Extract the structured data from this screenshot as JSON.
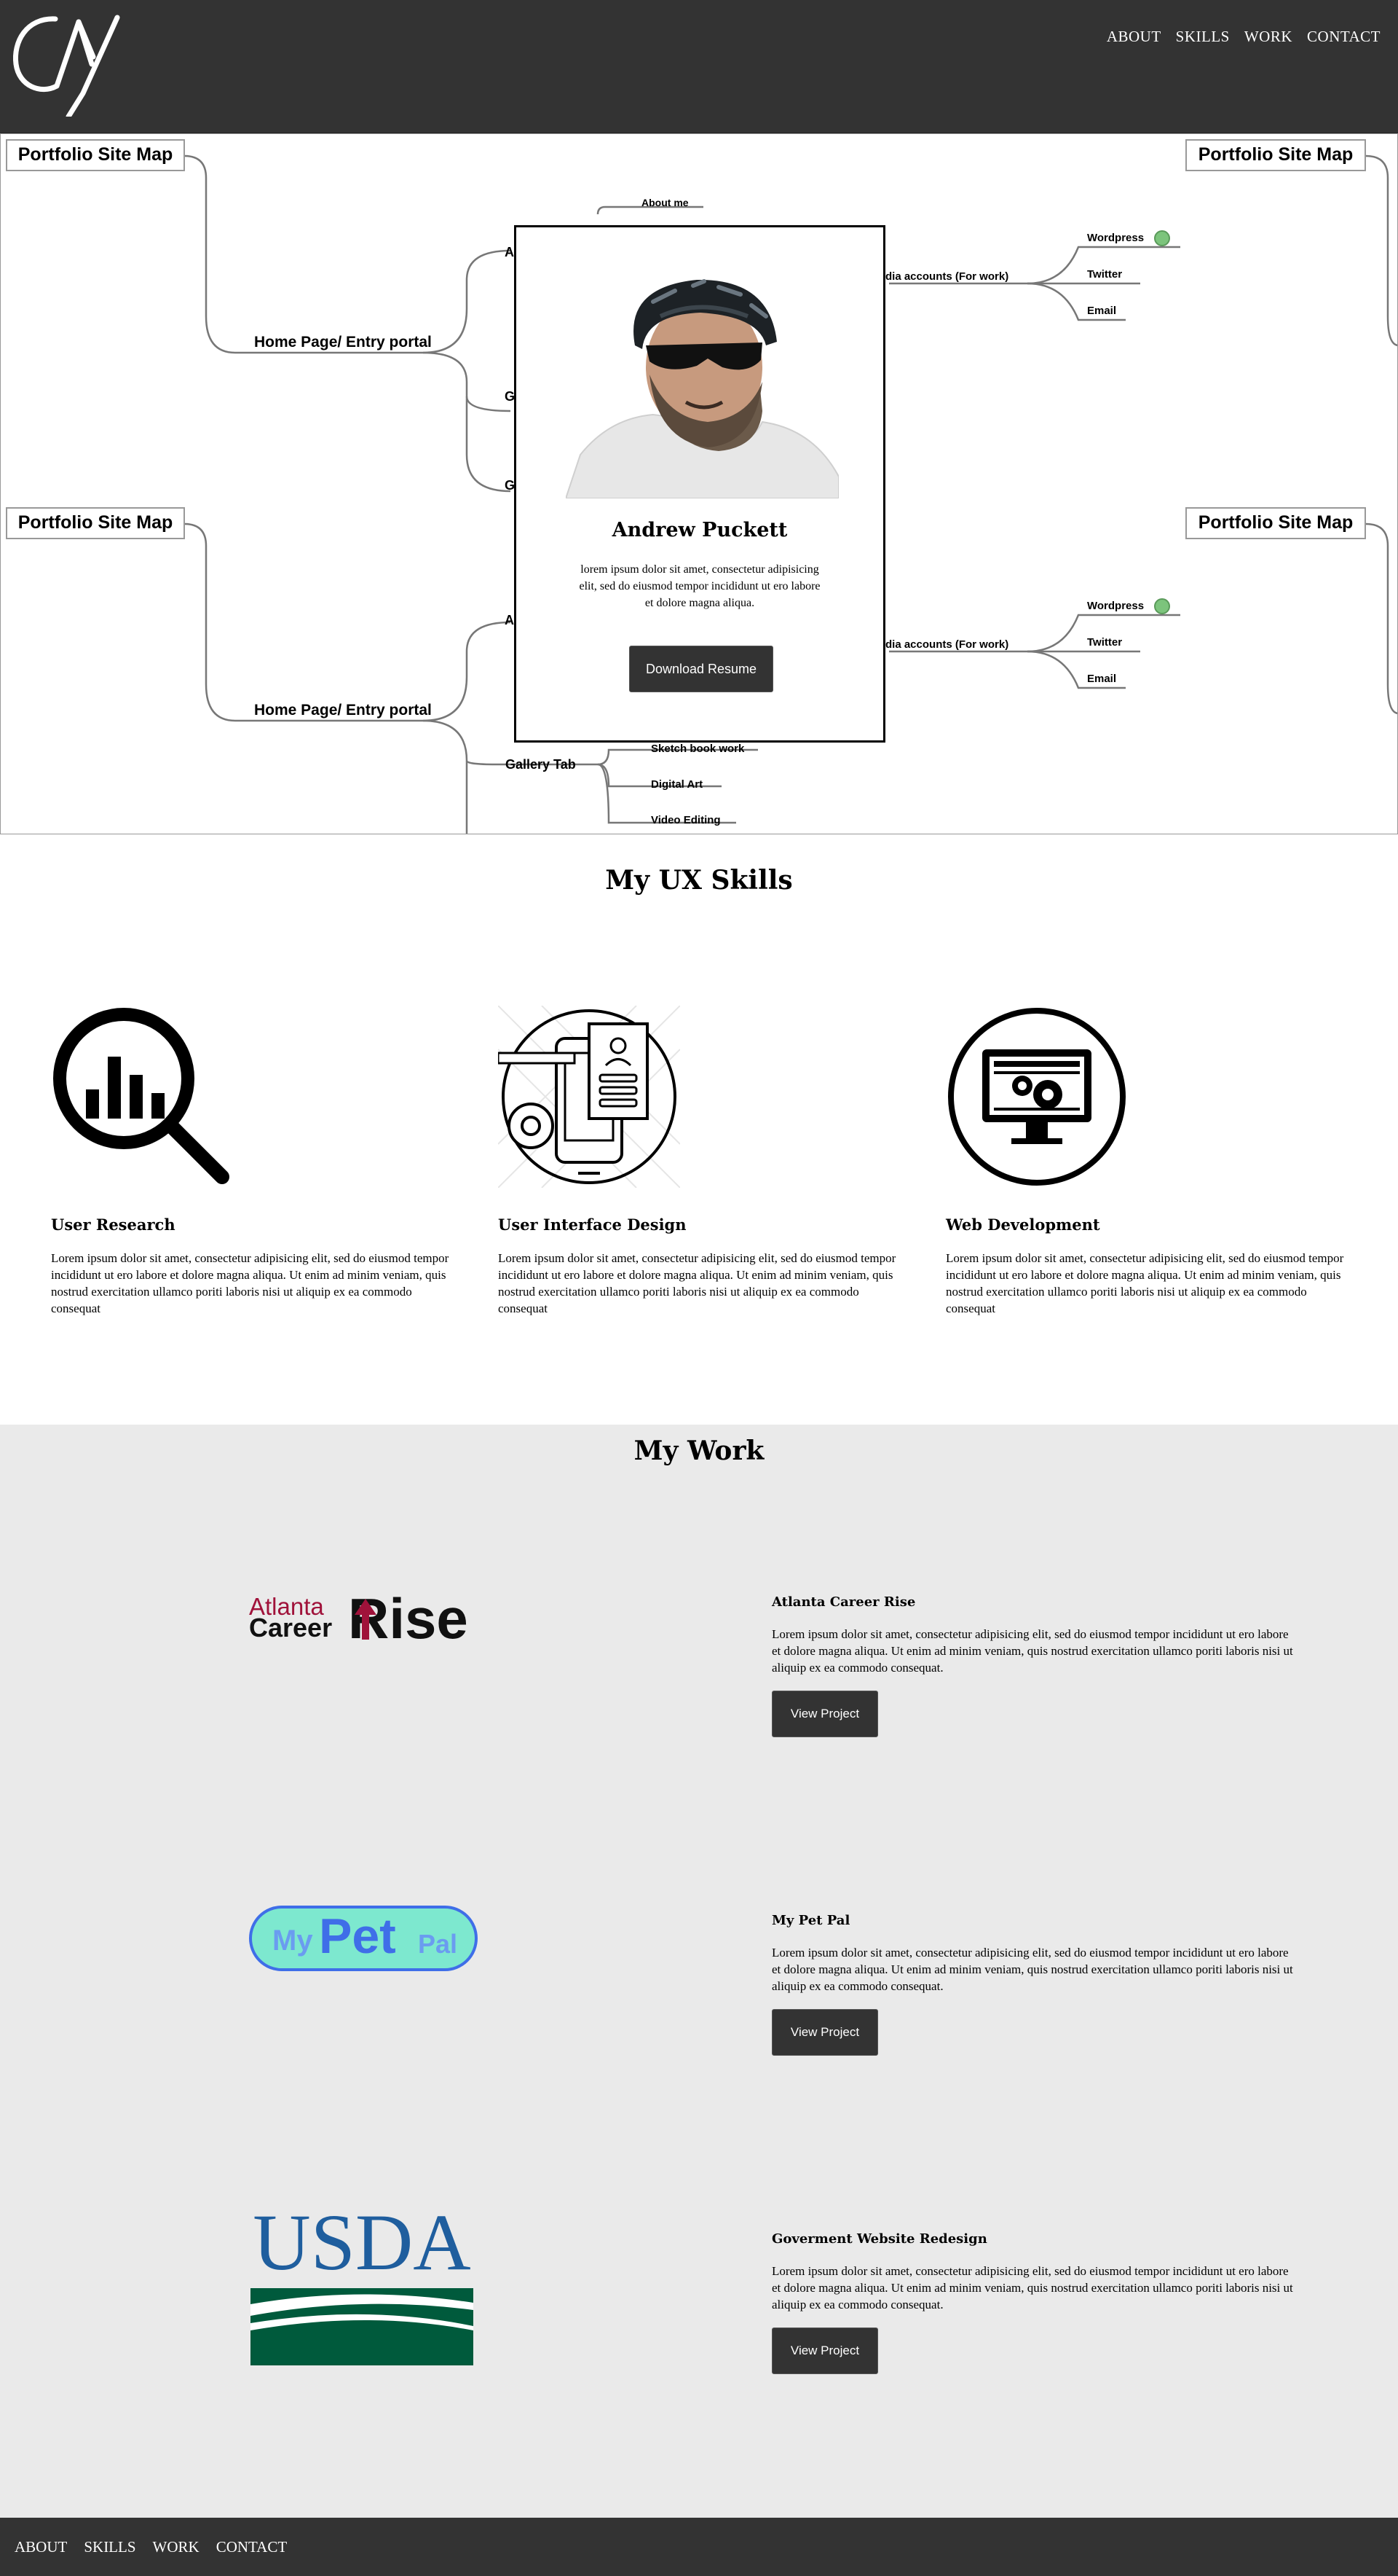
{
  "header": {
    "logo_alt": "AY",
    "nav": [
      "ABOUT",
      "SKILLS",
      "WORK",
      "CONTACT"
    ]
  },
  "sitemap": {
    "portfolio_label": "Portfolio Site Map",
    "home_label": "Home Page/ Entry portal",
    "about_label": "About me",
    "branch_a": "A",
    "branch_g": "G",
    "social_label": "dia accounts (For work)",
    "wordpress": "Wordpress",
    "twitter": "Twitter",
    "email": "Email",
    "gallery_tab": "Gallery Tab",
    "sketch": "Sketch book work",
    "digital_art": "Digital Art",
    "video_editing": "Video Editing"
  },
  "profile": {
    "name": "Andrew Puckett",
    "description": "lorem ipsum dolor sit amet, consectetur adipisicing elit, sed do eiusmod tempor incididunt ut ero labore et dolore magna aliqua.",
    "button": "Download Resume"
  },
  "skills": {
    "title": "My UX Skills",
    "items": [
      {
        "title": "User Research",
        "icon": "magnifier-chart-icon",
        "text": "Lorem ipsum dolor sit amet, consectetur adipisicing elit, sed do eiusmod tempor incididunt ut ero labore et dolore magna aliqua. Ut enim ad minim veniam, quis nostrud exercitation ullamco poriti laboris nisi ut aliquip ex ea commodo consequat"
      },
      {
        "title": "User Interface Design",
        "icon": "mobile-ui-icon",
        "text": "Lorem ipsum dolor sit amet, consectetur adipisicing elit, sed do eiusmod tempor incididunt ut ero labore et dolore magna aliqua. Ut enim ad minim veniam, quis nostrud exercitation ullamco poriti laboris nisi ut aliquip ex ea commodo consequat"
      },
      {
        "title": "Web Development",
        "icon": "monitor-gears-icon",
        "text": "Lorem ipsum dolor sit amet, consectetur adipisicing elit, sed do eiusmod tempor incididunt ut ero labore et dolore magna aliqua. Ut enim ad minim veniam, quis nostrud exercitation ullamco poriti laboris nisi ut aliquip ex ea commodo consequat"
      }
    ]
  },
  "work": {
    "title": "My Work",
    "projects": [
      {
        "title": "Atlanta Career Rise",
        "logo_top": "Atlanta",
        "logo_mid": "Career",
        "logo_big": "Rise",
        "text": "Lorem ipsum dolor sit amet, consectetur adipisicing elit, sed do eiusmod tempor incididunt ut ero labore et dolore magna aliqua. Ut enim ad minim veniam, quis nostrud exercitation ullamco poriti laboris nisi ut aliquip ex ea commodo consequat.",
        "button": "View Project"
      },
      {
        "title": "My Pet Pal",
        "logo_my": "My",
        "logo_pet": "Pet",
        "logo_pal": "Pal",
        "text": "Lorem ipsum dolor sit amet, consectetur adipisicing elit, sed do eiusmod tempor incididunt ut ero labore et dolore magna aliqua. Ut enim ad minim veniam, quis nostrud exercitation ullamco poriti laboris nisi ut aliquip ex ea commodo consequat.",
        "button": "View Project"
      },
      {
        "title": "Goverment Website Redesign",
        "logo_text": "USDA",
        "text": "Lorem ipsum dolor sit amet, consectetur adipisicing elit, sed do eiusmod tempor incididunt ut ero labore et dolore magna aliqua. Ut enim ad minim veniam, quis nostrud exercitation ullamco poriti laboris nisi ut aliquip ex ea commodo consequat.",
        "button": "View Project"
      }
    ]
  },
  "footer": {
    "nav": [
      "ABOUT",
      "SKILLS",
      "WORK",
      "CONTACT"
    ]
  },
  "colors": {
    "dark": "#333333",
    "work_bg": "#eaeaea",
    "usda_blue": "#1f5e9e",
    "usda_green": "#005a3c",
    "pet_bg": "#7de8cf",
    "pet_blue": "#3f6ee8",
    "rise_red": "#a0123a"
  }
}
